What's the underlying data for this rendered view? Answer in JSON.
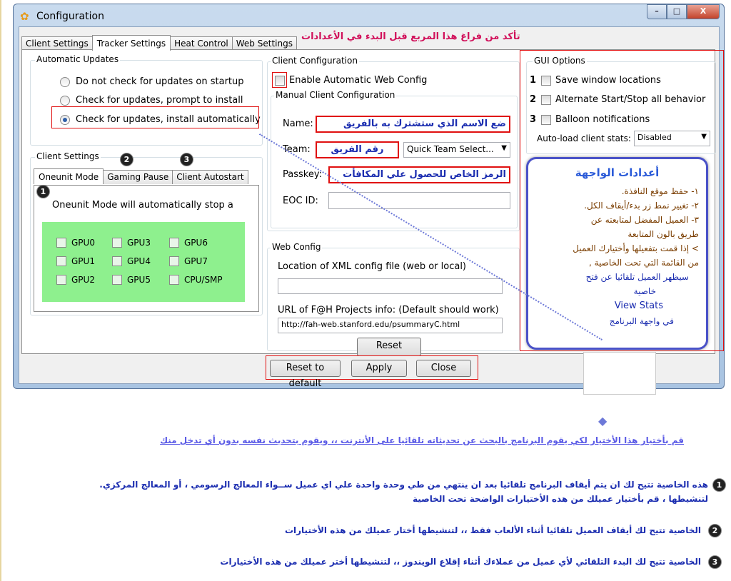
{
  "window": {
    "title": "Configuration",
    "buttons": {
      "minimize": "–",
      "maximize": "□",
      "close": "X"
    }
  },
  "tabs": [
    "Client Settings",
    "Tracker Settings",
    "Heat Control",
    "Web Settings"
  ],
  "annotation_top": "تأكد من فراغ هذا المربع قبل البدء في الأعدادات",
  "automatic_updates": {
    "legend": "Automatic Updates",
    "options": [
      "Do not check for updates on startup",
      "Check for updates, prompt to install",
      "Check for updates, install automatically"
    ],
    "selected_index": 2
  },
  "client_settings": {
    "legend": "Client Settings",
    "subtabs": [
      "Oneunit Mode",
      "Gaming Pause",
      "Client Autostart"
    ],
    "badges": [
      "2",
      "3",
      "1"
    ],
    "description": "Oneunit Mode will automatically stop a",
    "gpus": [
      "GPU0",
      "GPU3",
      "GPU6",
      "GPU1",
      "GPU4",
      "GPU7",
      "GPU2",
      "GPU5",
      "CPU/SMP"
    ]
  },
  "client_configuration": {
    "legend": "Client Configuration",
    "enable_web_config": "Enable Automatic Web Config",
    "manual_legend": "Manual Client Configuration",
    "name_label": "Name:",
    "name_value": "ضع الاسم الذي ستشترك به بالفريق",
    "team_label": "Team:",
    "team_value": "رقم الفريق",
    "team_select": "Quick Team Select...",
    "passkey_label": "Passkey:",
    "passkey_value": "الرمز الخاص للحصول علي المكافأت",
    "eoc_label": "EOC ID:"
  },
  "web_config": {
    "legend": "Web Config",
    "xml_label": "Location of XML config file (web or local)",
    "xml_value": "",
    "url_label": "URL of F@H Projects info: (Default should work)",
    "url_value": "http://fah-web.stanford.edu/psummaryC.html",
    "reset": "Reset"
  },
  "gui_options": {
    "legend": "GUI Options",
    "items": [
      {
        "num": "1",
        "label": "Save window locations"
      },
      {
        "num": "2",
        "label": "Alternate Start/Stop all behavior"
      },
      {
        "num": "3",
        "label": "Balloon notifications"
      }
    ],
    "autoload_label": "Auto-load client stats:",
    "autoload_value": "Disabled"
  },
  "info_box": {
    "title": "أعدادات الواجهة",
    "lines": [
      "١- حفظ موقع النافذة.",
      "٢- تغيير نمط زر بدء/أيقاف الكل.",
      "٣- العميل المفضل لمتابعته عن",
      "طريق بالون المتابعة",
      "> إذا قمت بتفعيلها وأختيارك العميل",
      "من القائمة التي تحت الخاصية ,",
      "سيظهر العميل تلقائيا عن فتح",
      "خاصية",
      "View Stats",
      "في واجهة البرنامج"
    ]
  },
  "dialog_buttons": {
    "reset_default": "Reset to default",
    "apply": "Apply",
    "close": "Close"
  },
  "explanations": {
    "auto_update": "قم بأختيار هذا الأختيار لكي يقوم البرنامج بالبحث عن تحديثاته تلقائيا على الأنترنت ،، ويقوم بتحديث نفسه بدون أي تدخل منك",
    "oneunit_line1": "هذه الخاصية تتيح لك ان يتم أيقاف البرنامج تلقائيا بعد ان ينتهي من طي وحدة واحدة علي اي عميل ســواء المعالج الرسومي ، أو المعالج المركزي.",
    "oneunit_line2": "لتنشيطها ، قم بأختيار عميلك من هذه الأختيارات الواضحة تحت الخاصية",
    "gaming_pause": "الخاصية تتيح لك أيقاف العميل تلقائيا أثناء الألعاب فقط ،، لتنشيطها أختار عميلك من هذه الأختيارات",
    "autostart": "الخاصية تتيح لك البدء التلقائي لأي عميل من عملاءك أثناء إقلاع الويندوز ،، لتنشيطها أختر عميلك من هذه الأختيارات",
    "nums": [
      "1",
      "2",
      "3"
    ]
  }
}
